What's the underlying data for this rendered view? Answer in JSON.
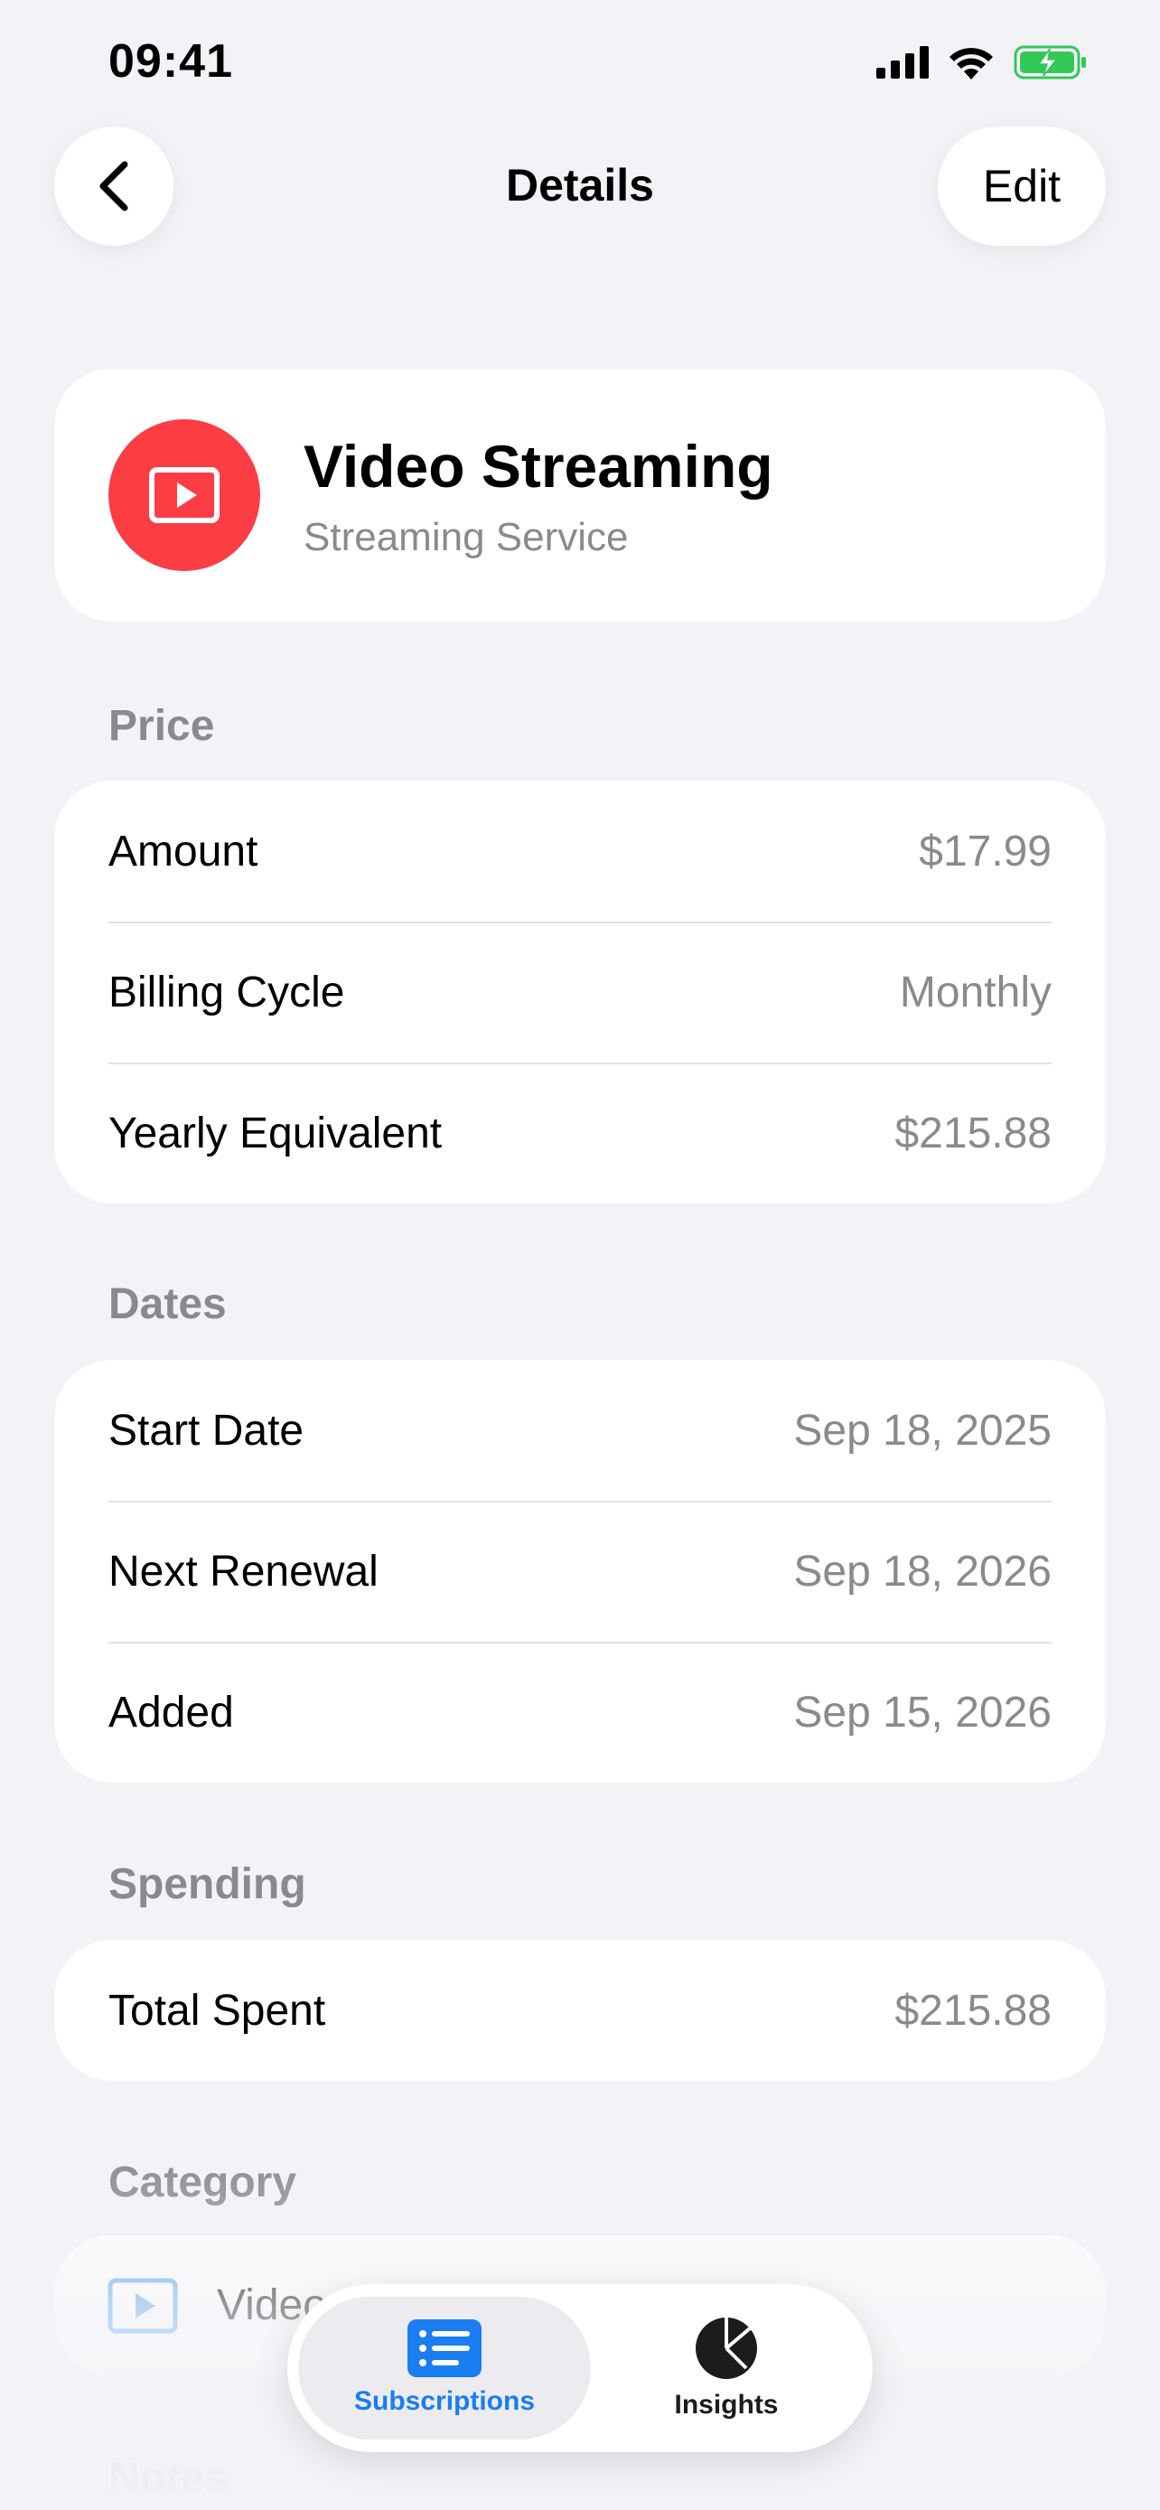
{
  "status_bar": {
    "time": "09:41"
  },
  "nav": {
    "title": "Details",
    "edit_label": "Edit"
  },
  "subscription": {
    "name": "Video Streaming",
    "type": "Streaming Service",
    "icon": "play-icon",
    "icon_color": "#fc3d43"
  },
  "sections": {
    "price": {
      "label": "Price",
      "rows": [
        {
          "label": "Amount",
          "value": "$17.99"
        },
        {
          "label": "Billing Cycle",
          "value": "Monthly"
        },
        {
          "label": "Yearly Equivalent",
          "value": "$215.88"
        }
      ]
    },
    "dates": {
      "label": "Dates",
      "rows": [
        {
          "label": "Start Date",
          "value": "Sep 18, 2025"
        },
        {
          "label": "Next Renewal",
          "value": "Sep 18, 2026"
        },
        {
          "label": "Added",
          "value": "Sep 15, 2026"
        }
      ]
    },
    "spending": {
      "label": "Spending",
      "rows": [
        {
          "label": "Total Spent",
          "value": "$215.88"
        }
      ]
    },
    "category": {
      "label": "Category",
      "value": "Video",
      "icon": "video-category-icon",
      "icon_color": "#5aa6f0"
    },
    "notes": {
      "label": "Notes"
    }
  },
  "tab_bar": {
    "tabs": [
      {
        "label": "Subscriptions",
        "icon": "list-icon",
        "selected": true
      },
      {
        "label": "Insights",
        "icon": "pie-chart-icon",
        "selected": false
      }
    ],
    "accent": "#1a7df1"
  }
}
